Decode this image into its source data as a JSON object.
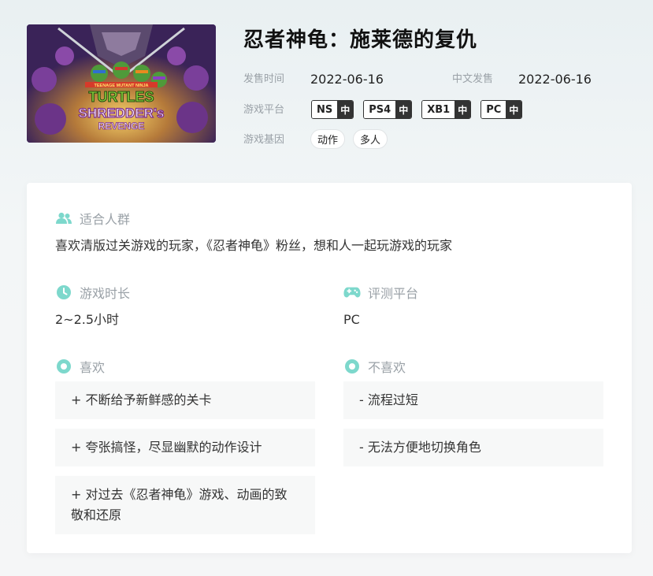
{
  "game": {
    "title": "忍者神龟：施莱德的复仇",
    "cover_alt": "TEENAGE MUTANT NINJA TURTLES SHREDDER'S REVENGE",
    "cover_logo": {
      "line1": "TEENAGE MUTANT NINJA",
      "line2": "TURTLES",
      "line3": "SHREDDER's",
      "line4": "REVENGE"
    }
  },
  "meta": {
    "release_label": "发售时间",
    "release_date": "2022-06-16",
    "chinese_label": "中文发售",
    "chinese_date": "2022-06-16",
    "platform_label": "游戏平台",
    "platforms": [
      {
        "name": "NS",
        "lang": "中"
      },
      {
        "name": "PS4",
        "lang": "中"
      },
      {
        "name": "XB1",
        "lang": "中"
      },
      {
        "name": "PC",
        "lang": "中"
      }
    ],
    "gene_label": "游戏基因",
    "genes": [
      "动作",
      "多人"
    ]
  },
  "review": {
    "audience": {
      "icon": "people-icon",
      "title": "适合人群",
      "text": "喜欢清版过关游戏的玩家，《忍者神龟》粉丝，想和人一起玩游戏的玩家"
    },
    "duration": {
      "icon": "clock-icon",
      "title": "游戏时长",
      "text": "2~2.5小时"
    },
    "platform": {
      "icon": "gamepad-icon",
      "title": "评测平台",
      "text": "PC"
    },
    "likes": {
      "icon": "circle-icon",
      "title": "喜欢",
      "items": [
        "+ 不断给予新鲜感的关卡",
        "+ 夸张搞怪，尽显幽默的动作设计",
        "+ 对过去《忍者神龟》游戏、动画的致敬和还原"
      ]
    },
    "dislikes": {
      "icon": "circle-icon",
      "title": "不喜欢",
      "items": [
        "- 流程过短",
        "- 无法方便地切换角色"
      ]
    }
  },
  "colors": {
    "accent": "#7dd8cc",
    "label": "#9aa1a7",
    "text": "#333333"
  }
}
